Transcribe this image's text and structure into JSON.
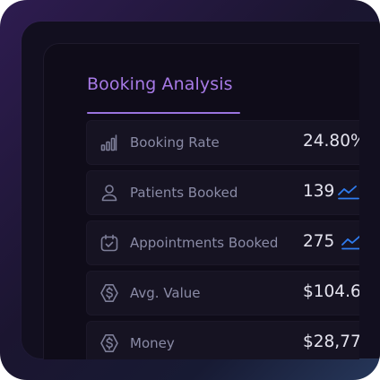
{
  "panel": {
    "title": "Booking Analysis"
  },
  "metrics": [
    {
      "label": "Booking Rate",
      "value": "24.80%",
      "icon": "bar-chart-icon"
    },
    {
      "label": "Patients Booked",
      "value": "139",
      "icon": "user-icon",
      "trend": "trend-up-icon"
    },
    {
      "label": "Appointments Booked",
      "value": "275",
      "icon": "calendar-check-icon",
      "trend": "trend-up-icon"
    },
    {
      "label": "Avg. Value",
      "value": "$104.6",
      "icon": "dollar-icon"
    },
    {
      "label": "Money",
      "value": "$28,77",
      "icon": "dollar-icon"
    }
  ],
  "colors": {
    "accent": "#a77ae6",
    "trend": "#2f7cf0",
    "label": "#8a8ba6",
    "value": "#e4e3ee"
  }
}
